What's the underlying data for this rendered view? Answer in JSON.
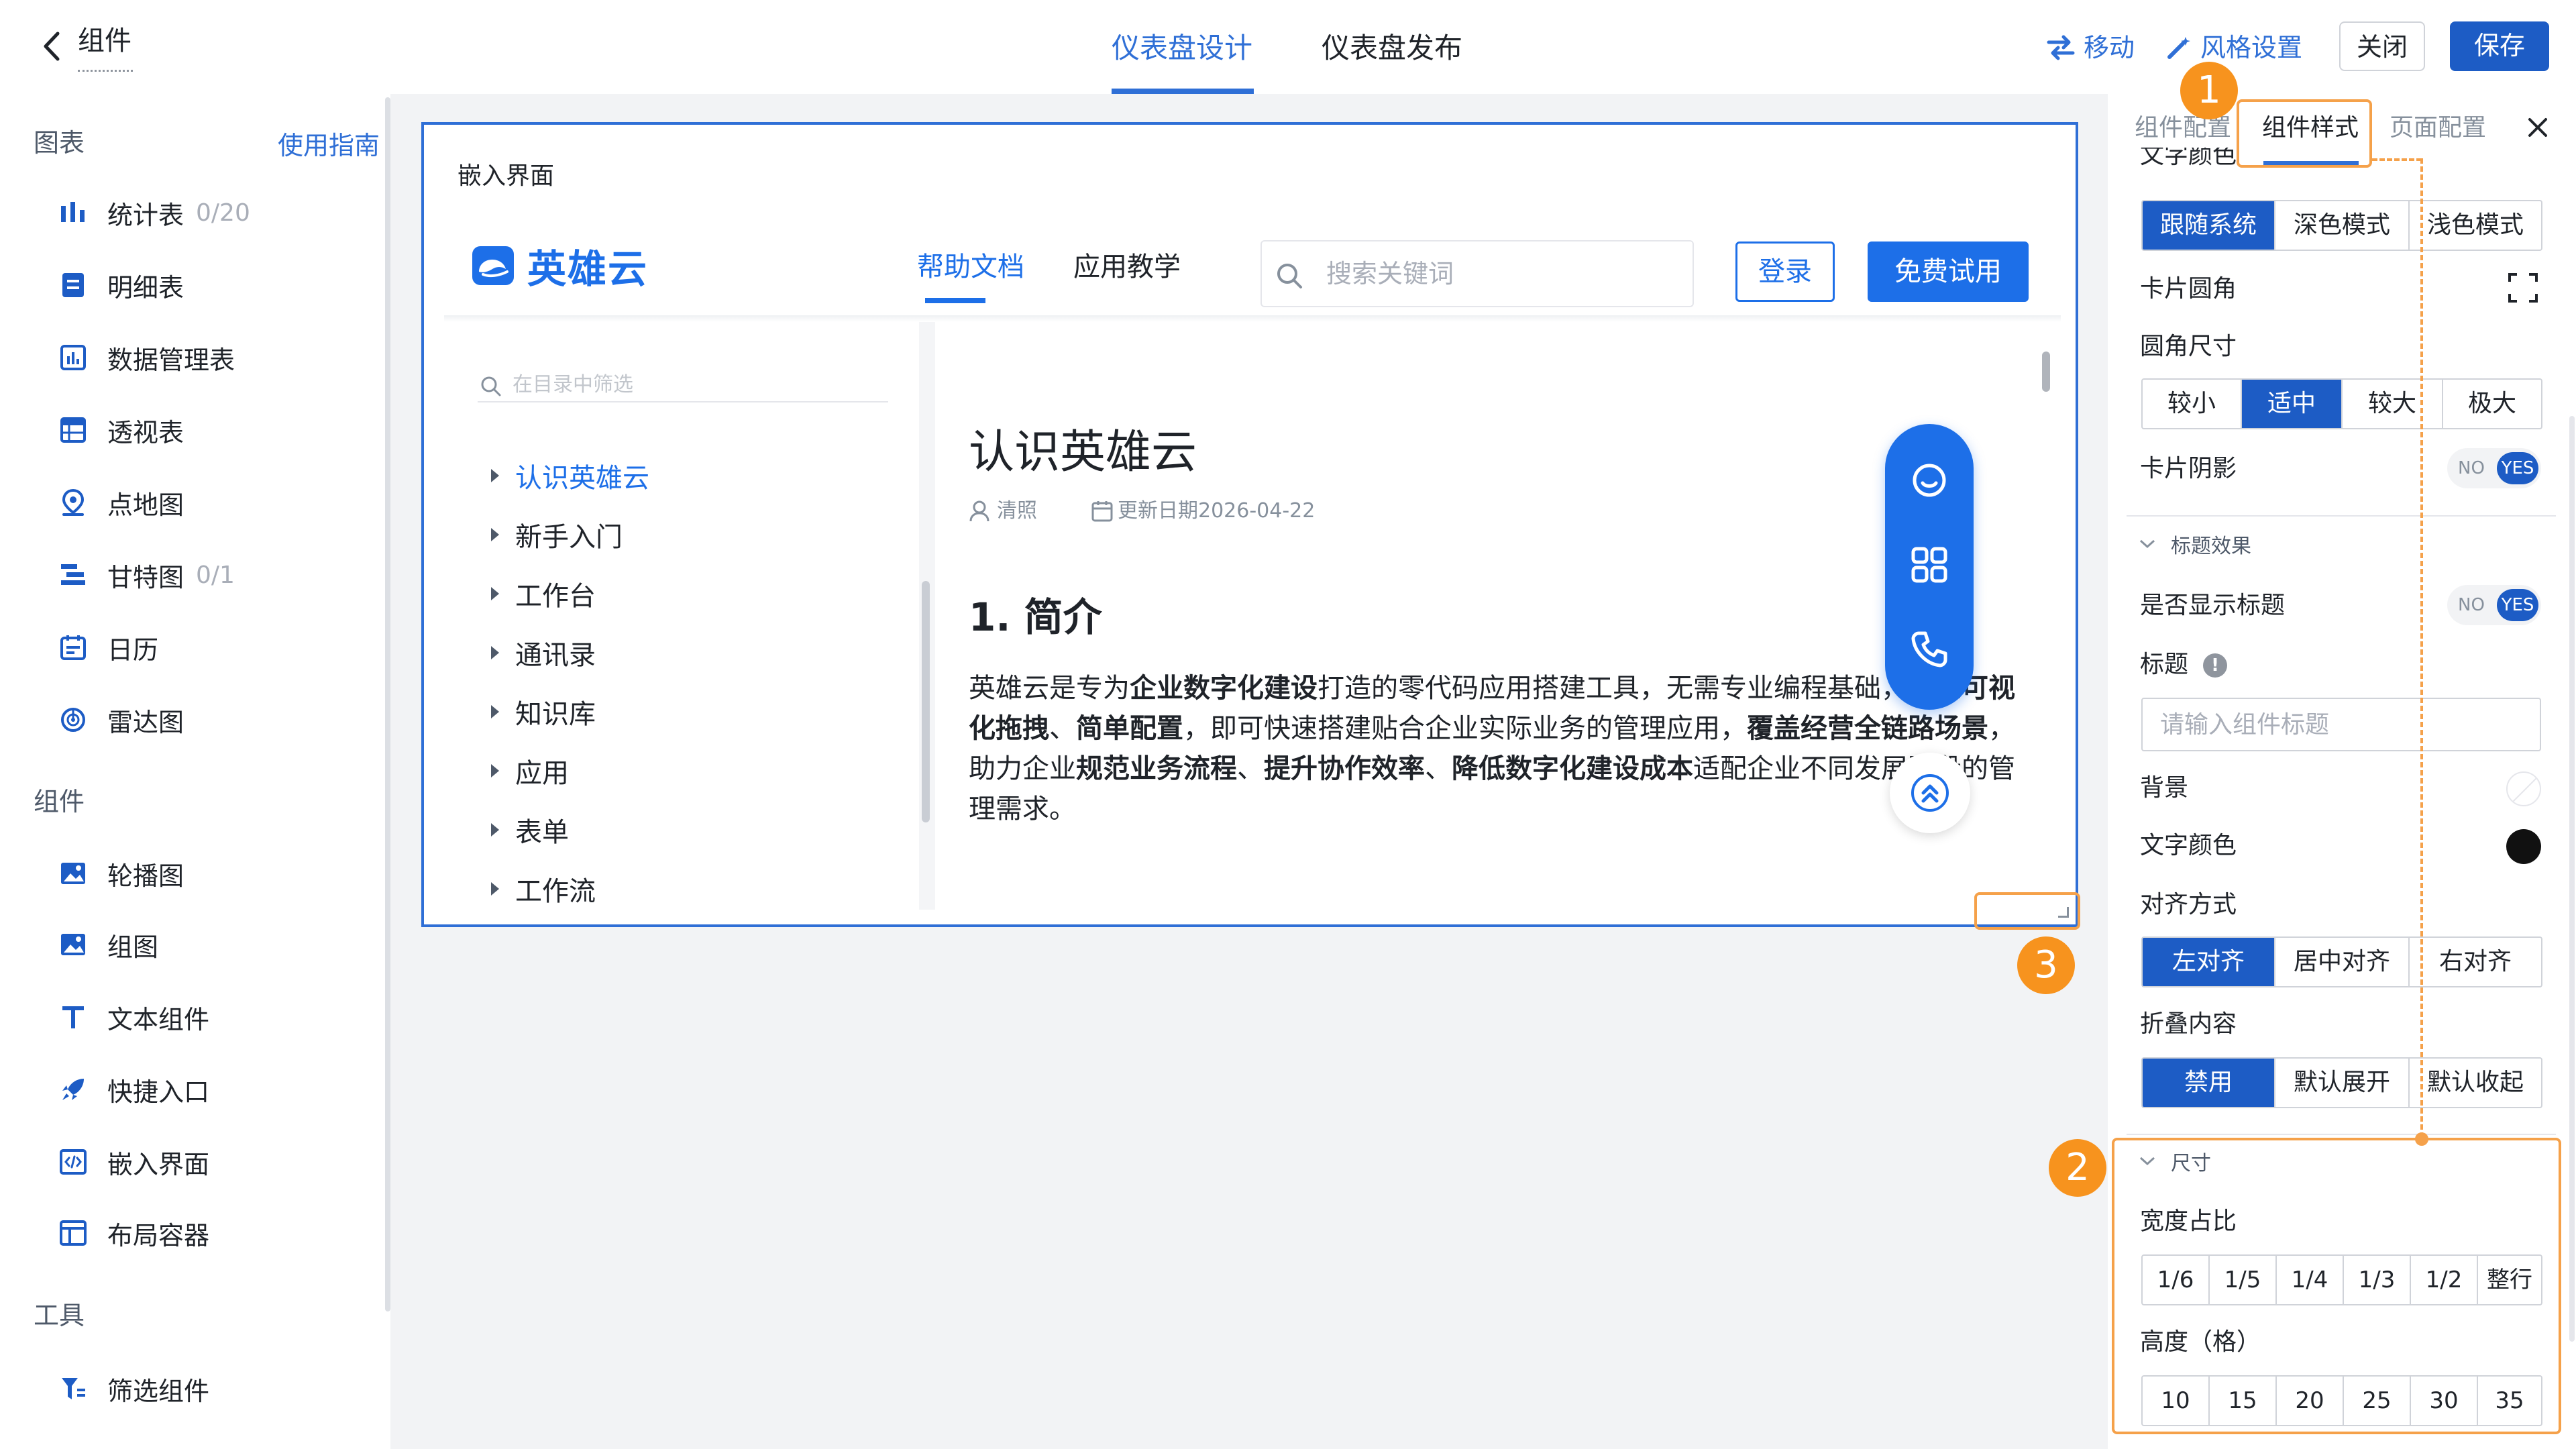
{
  "header": {
    "title": "组件",
    "tabs": [
      {
        "label": "仪表盘设计",
        "active": true
      },
      {
        "label": "仪表盘发布",
        "active": false
      }
    ],
    "actions": {
      "move": "移动",
      "style_settings": "风格设置",
      "close": "关闭",
      "save": "保存"
    }
  },
  "left_sidebar": {
    "chart_section": "图表",
    "guide_link": "使用指南",
    "charts": [
      {
        "label": "统计表",
        "count": "0/20",
        "icon": "bar-chart-icon"
      },
      {
        "label": "明细表",
        "count": "",
        "icon": "detail-list-icon"
      },
      {
        "label": "数据管理表",
        "count": "",
        "icon": "data-table-icon"
      },
      {
        "label": "透视表",
        "count": "",
        "icon": "pivot-table-icon"
      },
      {
        "label": "点地图",
        "count": "",
        "icon": "map-pin-icon"
      },
      {
        "label": "甘特图",
        "count": "0/1",
        "icon": "gantt-icon"
      },
      {
        "label": "日历",
        "count": "",
        "icon": "calendar-icon"
      },
      {
        "label": "雷达图",
        "count": "",
        "icon": "radar-icon"
      }
    ],
    "component_section": "组件",
    "components": [
      {
        "label": "轮播图",
        "icon": "carousel-image-icon"
      },
      {
        "label": "组图",
        "icon": "image-group-icon"
      },
      {
        "label": "文本组件",
        "icon": "text-icon"
      },
      {
        "label": "快捷入口",
        "icon": "rocket-icon"
      },
      {
        "label": "嵌入界面",
        "icon": "embed-code-icon"
      },
      {
        "label": "布局容器",
        "icon": "layout-container-icon"
      }
    ],
    "tool_section": "工具",
    "tools": [
      {
        "label": "筛选组件",
        "icon": "filter-icon"
      }
    ]
  },
  "embed_card": {
    "title": "嵌入界面",
    "site": {
      "logo_text": "英雄云",
      "nav": [
        {
          "label": "帮助文档",
          "active": true
        },
        {
          "label": "应用教学",
          "active": false
        }
      ],
      "search_placeholder": "搜索关键词",
      "login": "登录",
      "trial": "免费试用",
      "toc_filter_placeholder": "在目录中筛选",
      "toc": [
        {
          "label": "认识英雄云",
          "active": true
        },
        {
          "label": "新手入门",
          "active": false
        },
        {
          "label": "工作台",
          "active": false
        },
        {
          "label": "通讯录",
          "active": false
        },
        {
          "label": "知识库",
          "active": false
        },
        {
          "label": "应用",
          "active": false
        },
        {
          "label": "表单",
          "active": false
        },
        {
          "label": "工作流",
          "active": false
        }
      ],
      "article": {
        "title": "认识英雄云",
        "author": "清照",
        "updated": "更新日期2026-04-22",
        "section": "1. 简介",
        "para": [
          {
            "t": "英雄云是专为",
            "b": false
          },
          {
            "t": "企业数字化建设",
            "b": true
          },
          {
            "t": "打造的零代码应用搭建工具，无需专业编程基础，通过",
            "b": false
          },
          {
            "t": "可视化拖拽",
            "b": true
          },
          {
            "t": "、",
            "b": false
          },
          {
            "t": "简单配置",
            "b": true
          },
          {
            "t": "，即可快速搭建贴合企业实际业务的管理应用，",
            "b": false
          },
          {
            "t": "覆盖",
            "b": true
          },
          {
            "t": "经营",
            "b": true
          },
          {
            "t": "全链路场景",
            "b": true
          },
          {
            "t": "，助力企业",
            "b": false
          },
          {
            "t": "规范业务流程",
            "b": true
          },
          {
            "t": "、",
            "b": false
          },
          {
            "t": "提升协作效率",
            "b": true
          },
          {
            "t": "、",
            "b": false
          },
          {
            "t": "降低数字化建设成本",
            "b": true
          },
          {
            "t": "适配企业不同发展阶段的管理需求。",
            "b": false
          }
        ]
      }
    }
  },
  "annotations": [
    "1",
    "2",
    "3"
  ],
  "right_panel": {
    "tabs": [
      {
        "label": "组件配置",
        "active": false
      },
      {
        "label": "组件样式",
        "active": true
      },
      {
        "label": "页面配置",
        "active": false
      }
    ],
    "clipped_label": "文字颜色",
    "text_mode": {
      "options": [
        "跟随系统",
        "深色模式",
        "浅色模式"
      ],
      "selected": 0
    },
    "card_radius_label": "卡片圆角",
    "radius_size_label": "圆角尺寸",
    "radius_size": {
      "options": [
        "较小",
        "适中",
        "较大",
        "极大"
      ],
      "selected": 1
    },
    "card_shadow_label": "卡片阴影",
    "toggle_no": "NO",
    "toggle_yes": "YES",
    "title_effect_section": "标题效果",
    "show_title_label": "是否显示标题",
    "title_label": "标题",
    "title_placeholder": "请输入组件标题",
    "background_label": "背景",
    "text_color_label": "文字颜色",
    "align_label": "对齐方式",
    "align": {
      "options": [
        "左对齐",
        "居中对齐",
        "右对齐"
      ],
      "selected": 0
    },
    "fold_label": "折叠内容",
    "fold": {
      "options": [
        "禁用",
        "默认展开",
        "默认收起"
      ],
      "selected": 0
    },
    "size_section": "尺寸",
    "width_label": "宽度占比",
    "width": {
      "options": [
        "1/6",
        "1/5",
        "1/4",
        "1/3",
        "1/2",
        "整行"
      ]
    },
    "height_label": "高度（格）",
    "height": {
      "options": [
        "10",
        "15",
        "20",
        "25",
        "30",
        "35"
      ]
    }
  },
  "colors": {
    "accent": "#2f6fd6",
    "primary_button": "#1d5cc5",
    "site_brand": "#1d6fe8",
    "annotation": "#f7931e"
  }
}
